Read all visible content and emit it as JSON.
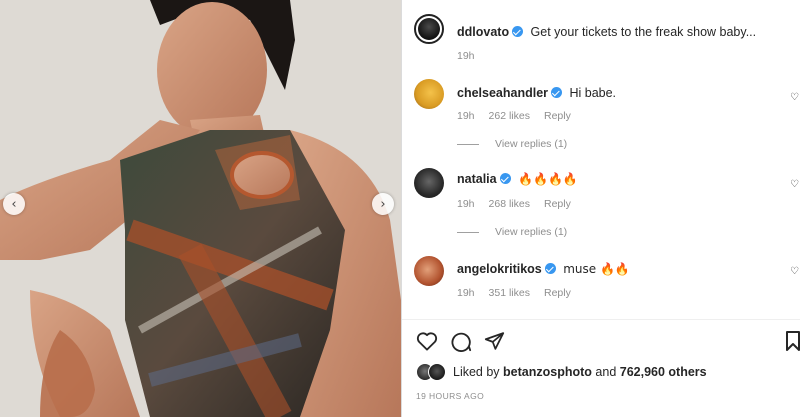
{
  "post": {
    "author": "ddlovato",
    "caption": "Get your tickets to the freak show baby...",
    "time": "19h"
  },
  "comments": [
    {
      "username": "chelseahandler",
      "text": "Hi babe.",
      "time": "19h",
      "likes": "262 likes",
      "reply": "Reply",
      "view_replies": "View replies (1)"
    },
    {
      "username": "natalia",
      "text": "🔥🔥🔥🔥",
      "time": "19h",
      "likes": "268 likes",
      "reply": "Reply",
      "view_replies": "View replies (1)"
    },
    {
      "username": "angelokritikos",
      "text": "muse 🔥🔥",
      "time": "19h",
      "likes": "351 likes",
      "reply": "Reply"
    }
  ],
  "likes": {
    "prefix": "Liked by",
    "user": "betanzosphoto",
    "and": "and",
    "others": "762,960 others"
  },
  "timestamp": "19 HOURS AGO",
  "icons": {
    "prev": "chevron-left-icon",
    "next": "chevron-right-icon",
    "like": "heart-icon",
    "comment": "comment-icon",
    "share": "share-icon",
    "save": "bookmark-icon"
  }
}
